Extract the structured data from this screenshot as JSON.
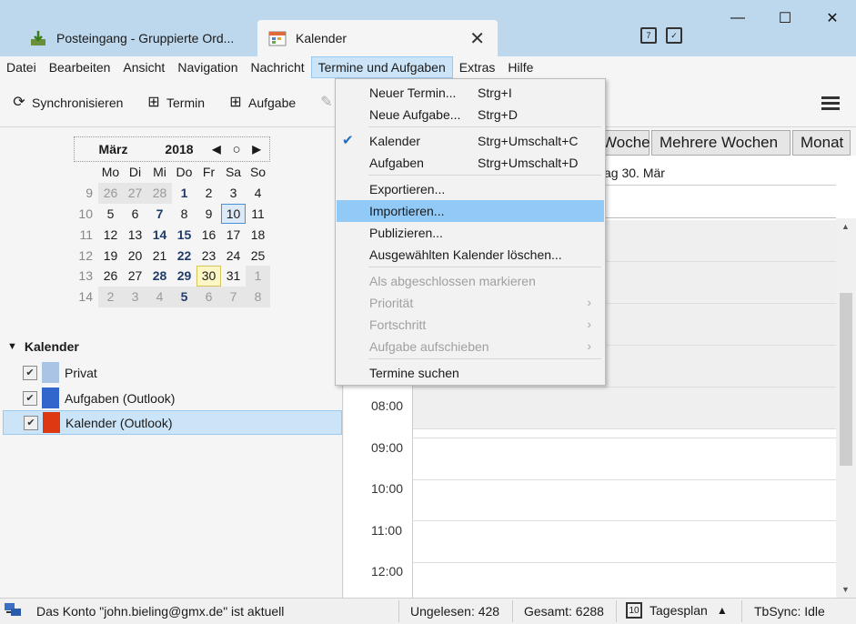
{
  "tabs": [
    {
      "label": "Posteingang - Gruppierte Ord...",
      "icon": "inbox-download-icon"
    },
    {
      "label": "Kalender",
      "icon": "calendar-tab-icon",
      "close": "✕"
    }
  ],
  "window_controls": {
    "minimize": "—",
    "maximize": "☐",
    "close": "✕"
  },
  "menubar": [
    "Datei",
    "Bearbeiten",
    "Ansicht",
    "Navigation",
    "Nachricht",
    "Termine und Aufgaben",
    "Extras",
    "Hilfe"
  ],
  "toolbar": {
    "sync": "Synchronisieren",
    "event": "Termin",
    "task": "Aufgabe"
  },
  "minical": {
    "month": "März",
    "year": "2018",
    "weekdays": [
      "Mo",
      "Di",
      "Mi",
      "Do",
      "Fr",
      "Sa",
      "So"
    ],
    "weeks": [
      {
        "wk": "9",
        "days": [
          "26",
          "27",
          "28",
          "1",
          "2",
          "3",
          "4"
        ]
      },
      {
        "wk": "10",
        "days": [
          "5",
          "6",
          "7",
          "8",
          "9",
          "10",
          "11"
        ]
      },
      {
        "wk": "11",
        "days": [
          "12",
          "13",
          "14",
          "15",
          "16",
          "17",
          "18"
        ]
      },
      {
        "wk": "12",
        "days": [
          "19",
          "20",
          "21",
          "22",
          "23",
          "24",
          "25"
        ]
      },
      {
        "wk": "13",
        "days": [
          "26",
          "27",
          "28",
          "29",
          "30",
          "31",
          "1"
        ]
      },
      {
        "wk": "14",
        "days": [
          "2",
          "3",
          "4",
          "5",
          "6",
          "7",
          "8"
        ]
      }
    ]
  },
  "calendars": {
    "header": "Kalender",
    "items": [
      {
        "label": "Privat",
        "color": "#a9c4e4",
        "checked": true
      },
      {
        "label": "Aufgaben (Outlook)",
        "color": "#3366cc",
        "checked": true
      },
      {
        "label": "Kalender (Outlook)",
        "color": "#dc3912",
        "checked": true
      }
    ]
  },
  "viewtabs": [
    "Woche",
    "Mehrere Wochen",
    "Monat"
  ],
  "dayheader": "ag 30. Mär",
  "hours": [
    "08:00",
    "09:00",
    "10:00",
    "11:00",
    "12:00"
  ],
  "dropdown": {
    "items": [
      {
        "label": "Neuer Termin...",
        "shortcut": "Strg+I"
      },
      {
        "label": "Neue Aufgabe...",
        "shortcut": "Strg+D"
      },
      {
        "label": "Kalender",
        "shortcut": "Strg+Umschalt+C",
        "checked": true
      },
      {
        "label": "Aufgaben",
        "shortcut": "Strg+Umschalt+D"
      },
      {
        "label": "Exportieren..."
      },
      {
        "label": "Importieren..."
      },
      {
        "label": "Publizieren..."
      },
      {
        "label": "Ausgewählten Kalender löschen..."
      },
      {
        "label": "Als abgeschlossen markieren"
      },
      {
        "label": "Priorität"
      },
      {
        "label": "Fortschritt"
      },
      {
        "label": "Aufgabe aufschieben"
      },
      {
        "label": "Termine suchen"
      }
    ]
  },
  "statusbar": {
    "account": "Das Konto \"john.bieling@gmx.de\" ist aktuell",
    "unread": "Ungelesen: 428",
    "total": "Gesamt: 6288",
    "dayplan": "Tagesplan",
    "tbsync": "TbSync: Idle"
  }
}
